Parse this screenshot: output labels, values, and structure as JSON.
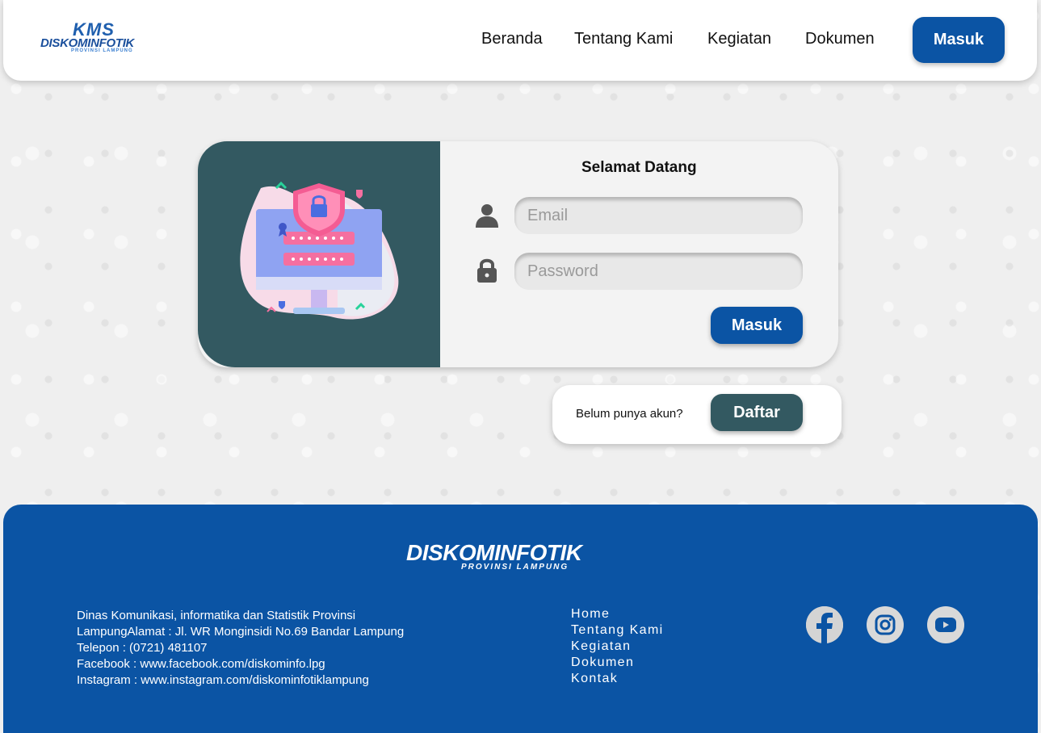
{
  "header": {
    "logo": {
      "top": "KMS",
      "brand": "DISKOMINFOTIK",
      "sub": "PROVINSI LAMPUNG"
    },
    "nav": [
      {
        "label": "Beranda"
      },
      {
        "label": "Tentang Kami"
      },
      {
        "label": "Kegiatan"
      },
      {
        "label": "Dokumen"
      }
    ],
    "login_label": "Masuk"
  },
  "login_card": {
    "title": "Selamat Datang",
    "email_placeholder": "Email",
    "password_placeholder": "Password",
    "submit_label": "Masuk"
  },
  "register": {
    "question": "Belum punya akun?",
    "button_label": "Daftar"
  },
  "footer": {
    "logo": {
      "brand": "DISKOMINFOTIK",
      "sub": "PROVINSI LAMPUNG"
    },
    "info": [
      "Dinas Komunikasi, informatika dan Statistik Provinsi",
      "LampungAlamat : Jl. WR Monginsidi No.69 Bandar Lampung",
      "Telepon : (0721) 481107",
      "Facebook : www.facebook.com/diskominfo.lpg",
      "Instagram : www.instagram.com/diskominfotiklampung"
    ],
    "links": [
      {
        "label": "Home"
      },
      {
        "label": "Tentang Kami"
      },
      {
        "label": "Kegiatan"
      },
      {
        "label": "Dokumen"
      },
      {
        "label": "Kontak"
      }
    ],
    "social": [
      "facebook-icon",
      "instagram-icon",
      "youtube-icon"
    ]
  },
  "colors": {
    "primary": "#0b54a4",
    "teal": "#335961",
    "card": "#f3f3f3"
  }
}
